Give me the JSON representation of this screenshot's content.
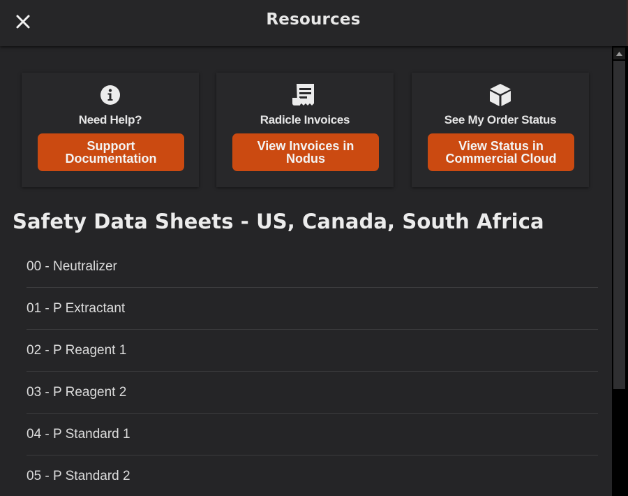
{
  "header": {
    "title": "Resources"
  },
  "cards": [
    {
      "icon": "info-circle-icon",
      "label": "Need Help?",
      "button": "Support Documentation"
    },
    {
      "icon": "invoice-receipt-icon",
      "label": "Radicle Invoices",
      "button": "View Invoices in Nodus"
    },
    {
      "icon": "box-package-icon",
      "label": "See My Order Status",
      "button": "View Status in Commercial Cloud"
    }
  ],
  "safety_data_sheets": {
    "title": "Safety Data Sheets - US, Canada, South Africa",
    "items": [
      "00 - Neutralizer",
      "01 - P Extractant",
      "02 - P Reagent 1",
      "03 - P Reagent 2",
      "04 - P Standard 1",
      "05 - P Standard 2"
    ]
  },
  "colors": {
    "accent": "#cb4a11",
    "background": "#252527",
    "text": "#e8e8e8"
  }
}
